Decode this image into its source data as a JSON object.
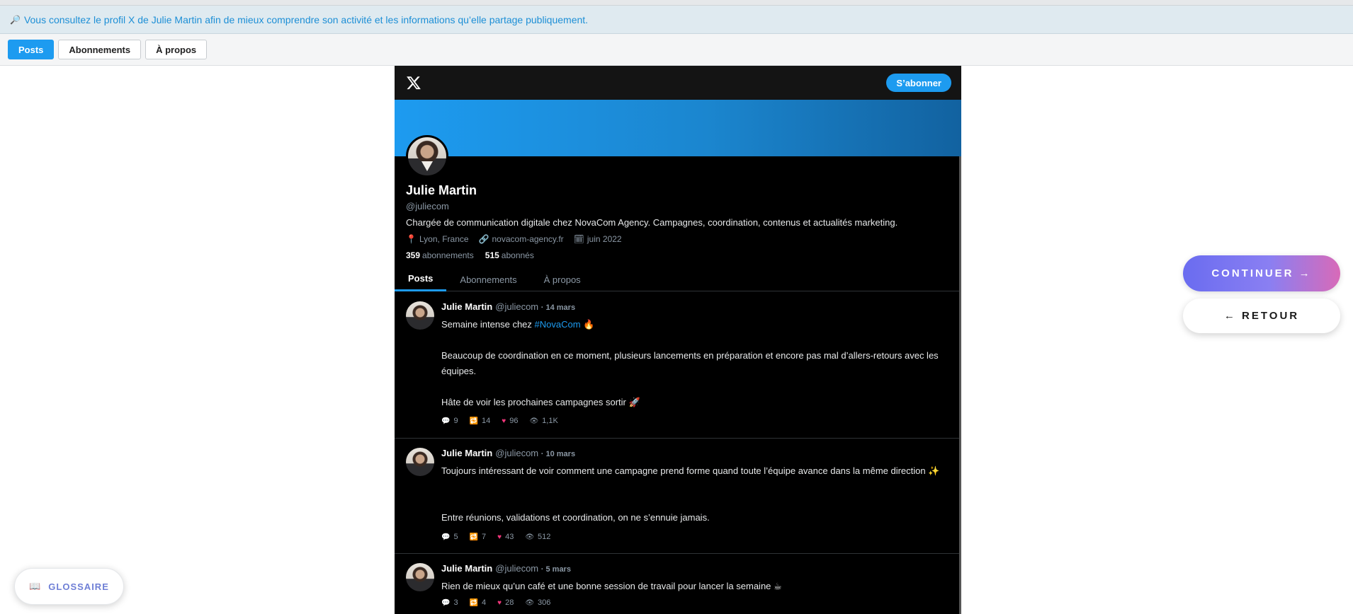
{
  "info_bar": {
    "text": "Vous consultez le profil X de Julie Martin afin de mieux comprendre son activité et les informations qu’elle partage publiquement."
  },
  "top_tabs": [
    {
      "label": "Posts"
    },
    {
      "label": "Abonnements"
    },
    {
      "label": "À propos"
    }
  ],
  "x_header": {
    "subscribe_label": "S’abonner"
  },
  "profile": {
    "name": "Julie Martin",
    "handle": "@juliecom",
    "bio": "Chargée de communication digitale chez NovaCom Agency. Campagnes, coordination, contenus et actualités marketing.",
    "location": "Lyon, France",
    "website": "novacom-agency.fr",
    "joined": "juin 2022",
    "following_count": "359",
    "following_label": "abonnements",
    "followers_count": "515",
    "followers_label": "abonnés"
  },
  "profile_tabs": [
    {
      "label": "Posts"
    },
    {
      "label": "Abonnements"
    },
    {
      "label": "À propos"
    }
  ],
  "posts": [
    {
      "name": "Julie Martin",
      "handle": "@juliecom",
      "date": "· 14 mars",
      "line1_pre": "Semaine intense chez ",
      "line1_tag": "#NovaCom",
      "line1_post": " 🔥",
      "para2": "Beaucoup de coordination en ce moment, plusieurs lancements en préparation et encore pas mal d’allers-retours avec les équipes.",
      "para3": "Hâte de voir les prochaines campagnes sortir 🚀",
      "replies": "9",
      "reposts": "14",
      "likes": "96",
      "views": "1,1K"
    },
    {
      "name": "Julie Martin",
      "handle": "@juliecom",
      "date": "· 10 mars",
      "para1": "Toujours intéressant de voir comment une campagne prend forme quand toute l’équipe avance dans la même direction ✨",
      "para2": "Entre réunions, validations et coordination, on ne s’ennuie jamais.",
      "replies": "5",
      "reposts": "7",
      "likes": "43",
      "views": "512"
    },
    {
      "name": "Julie Martin",
      "handle": "@juliecom",
      "date": "· 5 mars",
      "para1": "Rien de mieux qu’un café et une bonne session de travail pour lancer la semaine ☕",
      "replies": "3",
      "reposts": "4",
      "likes": "28",
      "views": "306"
    }
  ],
  "actions": {
    "continue_label": "CONTINUER →",
    "back_label": "← RETOUR"
  },
  "glossary": {
    "label": "GLOSSAIRE"
  },
  "icons": {
    "info": "magnifier-icon",
    "location": "pin-icon",
    "website": "link-icon",
    "joined": "calendar-icon",
    "reply": "comment-icon",
    "repost": "repost-icon",
    "like": "heart-icon",
    "views": "eye-icon",
    "glossary": "book-icon"
  },
  "colors": {
    "accent": "#1d9bf0",
    "info_text": "#1d8fd6",
    "like": "#f0367a"
  }
}
